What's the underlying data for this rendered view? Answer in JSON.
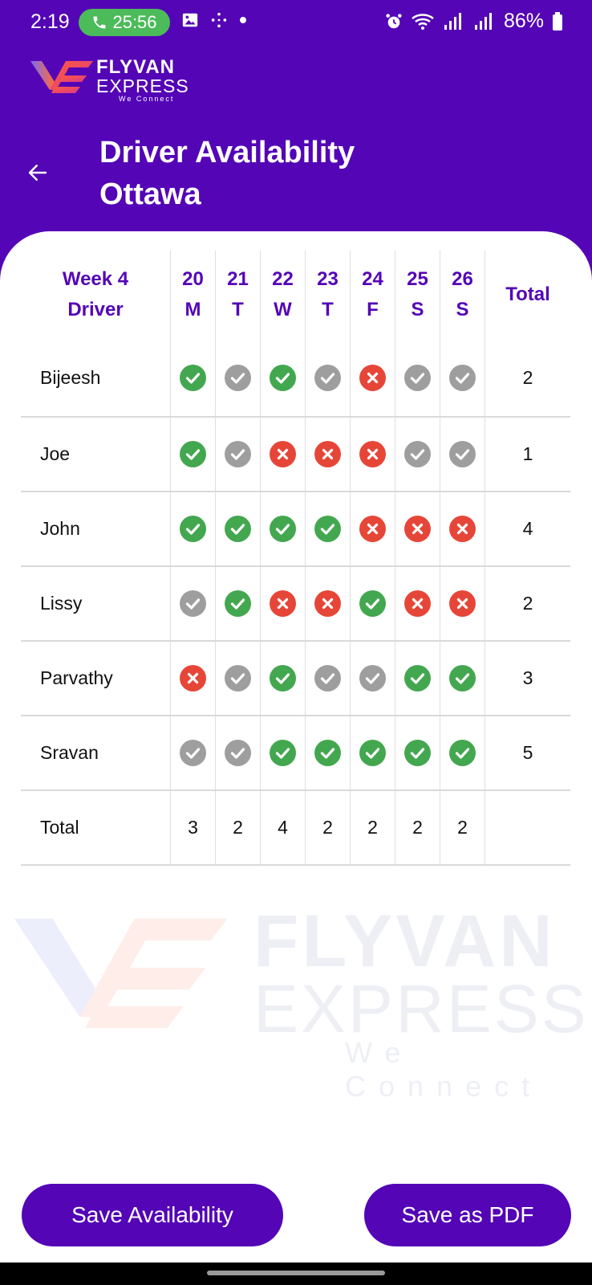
{
  "status": {
    "time": "2:19",
    "call_timer": "25:56",
    "battery": "86%"
  },
  "brand": {
    "line1": "FLYVAN",
    "line2": "EXPRESS",
    "tagline": "We Connect"
  },
  "header": {
    "title_line1": "Driver Availability",
    "title_line2": "Ottawa"
  },
  "table": {
    "week_label": "Week 4",
    "driver_label": "Driver",
    "total_label": "Total",
    "days": [
      {
        "date": "20",
        "dow": "M"
      },
      {
        "date": "21",
        "dow": "T"
      },
      {
        "date": "22",
        "dow": "W"
      },
      {
        "date": "23",
        "dow": "T"
      },
      {
        "date": "24",
        "dow": "F"
      },
      {
        "date": "25",
        "dow": "S"
      },
      {
        "date": "26",
        "dow": "S"
      }
    ],
    "rows": [
      {
        "name": "Bijeesh",
        "status": [
          "yes",
          "none",
          "yes",
          "none",
          "no",
          "none",
          "none"
        ],
        "total": "2"
      },
      {
        "name": "Joe",
        "status": [
          "yes",
          "none",
          "no",
          "no",
          "no",
          "none",
          "none"
        ],
        "total": "1"
      },
      {
        "name": "John",
        "status": [
          "yes",
          "yes",
          "yes",
          "yes",
          "no",
          "no",
          "no"
        ],
        "total": "4"
      },
      {
        "name": "Lissy",
        "status": [
          "none",
          "yes",
          "no",
          "no",
          "yes",
          "no",
          "no"
        ],
        "total": "2"
      },
      {
        "name": "Parvathy",
        "status": [
          "no",
          "none",
          "yes",
          "none",
          "none",
          "yes",
          "yes"
        ],
        "total": "3"
      },
      {
        "name": "Sravan",
        "status": [
          "none",
          "none",
          "yes",
          "yes",
          "yes",
          "yes",
          "yes"
        ],
        "total": "5"
      }
    ],
    "totals_label": "Total",
    "column_totals": [
      "3",
      "2",
      "4",
      "2",
      "2",
      "2",
      "2"
    ]
  },
  "colors": {
    "primary": "#5405b6",
    "yes": "#43a74f",
    "no": "#e64638",
    "none": "#9e9e9e"
  },
  "buttons": {
    "save_availability": "Save Availability",
    "save_pdf": "Save as PDF"
  }
}
